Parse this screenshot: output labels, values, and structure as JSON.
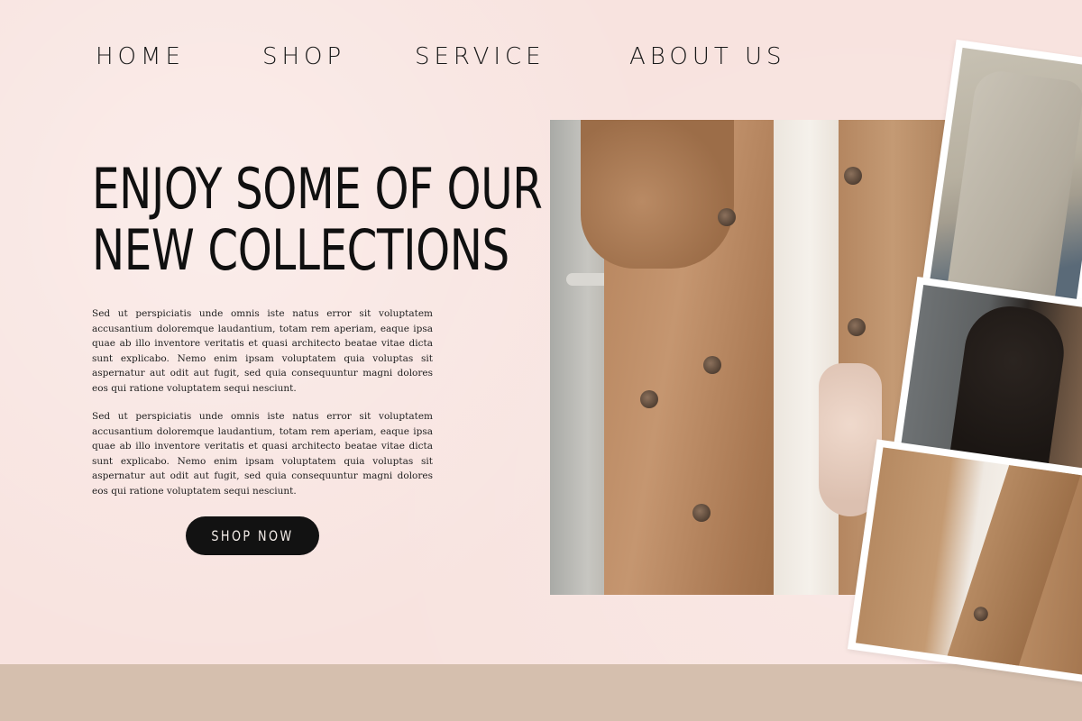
{
  "nav": {
    "items": [
      {
        "label": "HOME"
      },
      {
        "label": "SHOP"
      },
      {
        "label": "SERVICE"
      },
      {
        "label": "ABOUT US"
      }
    ]
  },
  "hero": {
    "headline_line1": "ENJOY SOME OF OUR",
    "headline_line2": "NEW COLLECTIONS",
    "paragraphs": [
      "Sed ut perspiciatis unde omnis iste natus error sit voluptatem accusantium doloremque laudantium, totam rem aperiam, eaque ipsa quae ab illo inventore veritatis et quasi architecto beatae vitae dicta sunt explicabo. Nemo enim ipsam voluptatem quia voluptas sit aspernatur aut odit aut fugit, sed quia consequuntur magni dolores eos qui ratione voluptatem sequi nesciunt.",
      "Sed ut perspiciatis unde omnis iste natus error sit voluptatem accusantium doloremque laudantium, totam rem aperiam, eaque ipsa quae ab illo inventore veritatis et quasi architecto beatae vitae dicta sunt explicabo. Nemo enim ipsam voluptatem quia voluptas sit aspernatur aut odit aut fugit, sed quia consequuntur magni dolores eos qui ratione voluptatem sequi nesciunt."
    ],
    "cta_label": "SHOP NOW"
  },
  "theme": {
    "background": "#f8e3df",
    "footer_band": "#d5bfae",
    "button_bg": "#121212",
    "button_text": "#f3ece8"
  },
  "images": {
    "main": "main-photo-trench-coat",
    "polaroids": [
      "polaroid-grey-coat",
      "polaroid-plaid-blazer",
      "polaroid-camel-coat"
    ]
  }
}
